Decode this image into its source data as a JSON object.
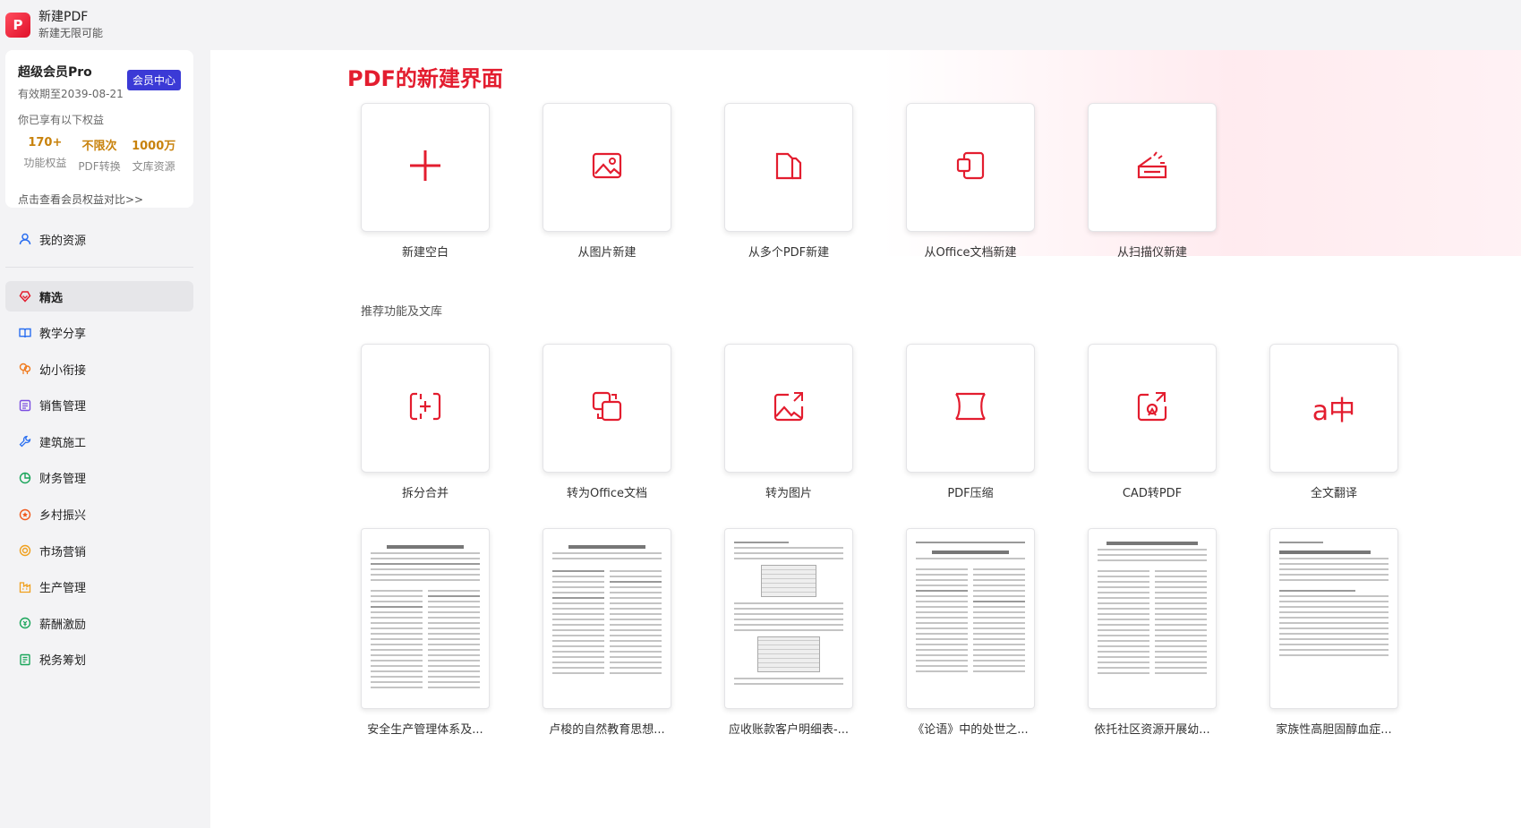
{
  "app": {
    "title": "新建PDF",
    "subtitle": "新建无限可能",
    "logo_glyph": "P"
  },
  "member": {
    "name": "超级会员Pro",
    "expiry": "有效期至2039-08-21",
    "center_button": "会员中心",
    "benefits_hint": "你已享有以下权益",
    "benefits": [
      {
        "value": "170+",
        "label": "功能权益"
      },
      {
        "value": "不限次",
        "label": "PDF转换"
      },
      {
        "value": "1000万",
        "label": "文库资源"
      }
    ],
    "compare_link": "点击查看会员权益对比>>"
  },
  "nav": {
    "resources": "我的资源",
    "items": [
      {
        "label": "精选",
        "icon": "heart-diamond-icon",
        "color": "#e31d2f"
      },
      {
        "label": "教学分享",
        "icon": "book-icon",
        "color": "#2b6ff0"
      },
      {
        "label": "幼小衔接",
        "icon": "balloon-icon",
        "color": "#f07a1d"
      },
      {
        "label": "销售管理",
        "icon": "list-icon",
        "color": "#7b4de0"
      },
      {
        "label": "建筑施工",
        "icon": "wrench-icon",
        "color": "#2b6ff0"
      },
      {
        "label": "财务管理",
        "icon": "pie-chart-icon",
        "color": "#1aa55a"
      },
      {
        "label": "乡村振兴",
        "icon": "star-badge-icon",
        "color": "#f05a1d"
      },
      {
        "label": "市场营销",
        "icon": "target-icon",
        "color": "#f0a01d"
      },
      {
        "label": "生产管理",
        "icon": "factory-icon",
        "color": "#f0a01d"
      },
      {
        "label": "薪酬激励",
        "icon": "coin-icon",
        "color": "#1aa55a"
      },
      {
        "label": "税务筹划",
        "icon": "ledger-icon",
        "color": "#1aa55a"
      }
    ]
  },
  "main": {
    "title": "PDF的新建界面",
    "create_tiles": [
      {
        "label": "新建空白",
        "icon": "plus-icon"
      },
      {
        "label": "从图片新建",
        "icon": "image-icon"
      },
      {
        "label": "从多个PDF新建",
        "icon": "multi-file-icon"
      },
      {
        "label": "从Office文档新建",
        "icon": "office-doc-icon"
      },
      {
        "label": "从扫描仪新建",
        "icon": "scanner-icon"
      }
    ],
    "section_title": "推荐功能及文库",
    "feature_tiles": [
      {
        "label": "拆分合并",
        "icon": "split-merge-icon"
      },
      {
        "label": "转为Office文档",
        "icon": "convert-office-icon"
      },
      {
        "label": "转为图片",
        "icon": "convert-image-icon"
      },
      {
        "label": "PDF压缩",
        "icon": "compress-icon"
      },
      {
        "label": "CAD转PDF",
        "icon": "cad-icon"
      },
      {
        "label": "全文翻译",
        "icon": "translate-icon",
        "glyph": "a中"
      }
    ],
    "documents": [
      {
        "label": "安全生产管理体系及..."
      },
      {
        "label": "卢梭的自然教育思想..."
      },
      {
        "label": "应收账款客户明细表-..."
      },
      {
        "label": "《论语》中的处世之..."
      },
      {
        "label": "依托社区资源开展幼..."
      },
      {
        "label": "家族性高胆固醇血症..."
      }
    ]
  },
  "colors": {
    "brand_red": "#e31d2f",
    "member_blue": "#3b3ad6",
    "benefit_gold": "#c8820c"
  }
}
